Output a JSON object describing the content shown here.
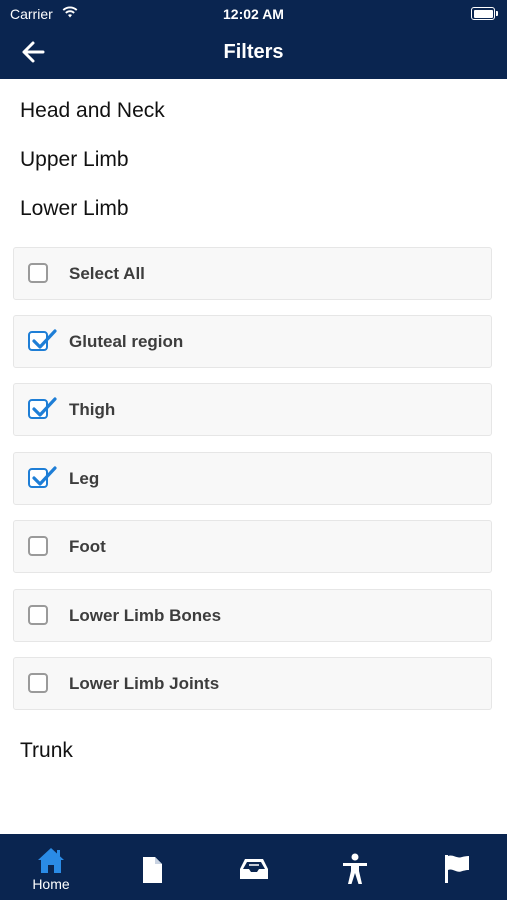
{
  "status_bar": {
    "carrier": "Carrier",
    "time": "12:02 AM"
  },
  "header": {
    "title": "Filters"
  },
  "sections": [
    {
      "label": "Head and Neck"
    },
    {
      "label": "Upper Limb"
    },
    {
      "label": "Lower Limb"
    },
    {
      "label": "Trunk"
    }
  ],
  "filters": [
    {
      "label": "Select All",
      "checked": false
    },
    {
      "label": "Gluteal region",
      "checked": true
    },
    {
      "label": "Thigh",
      "checked": true
    },
    {
      "label": "Leg",
      "checked": true
    },
    {
      "label": "Foot",
      "checked": false
    },
    {
      "label": "Lower Limb Bones",
      "checked": false
    },
    {
      "label": "Lower Limb Joints",
      "checked": false
    }
  ],
  "tabbar": {
    "tabs": [
      {
        "label": "Home",
        "icon": "home-icon",
        "active": true
      },
      {
        "icon": "document-icon"
      },
      {
        "icon": "inbox-tray-icon"
      },
      {
        "icon": "accessibility-person-icon"
      },
      {
        "icon": "flag-icon"
      }
    ]
  },
  "colors": {
    "header_bg": "#0a2550",
    "checkbox_accent": "#1e7ed6",
    "tab_active": "#2a8be6"
  }
}
